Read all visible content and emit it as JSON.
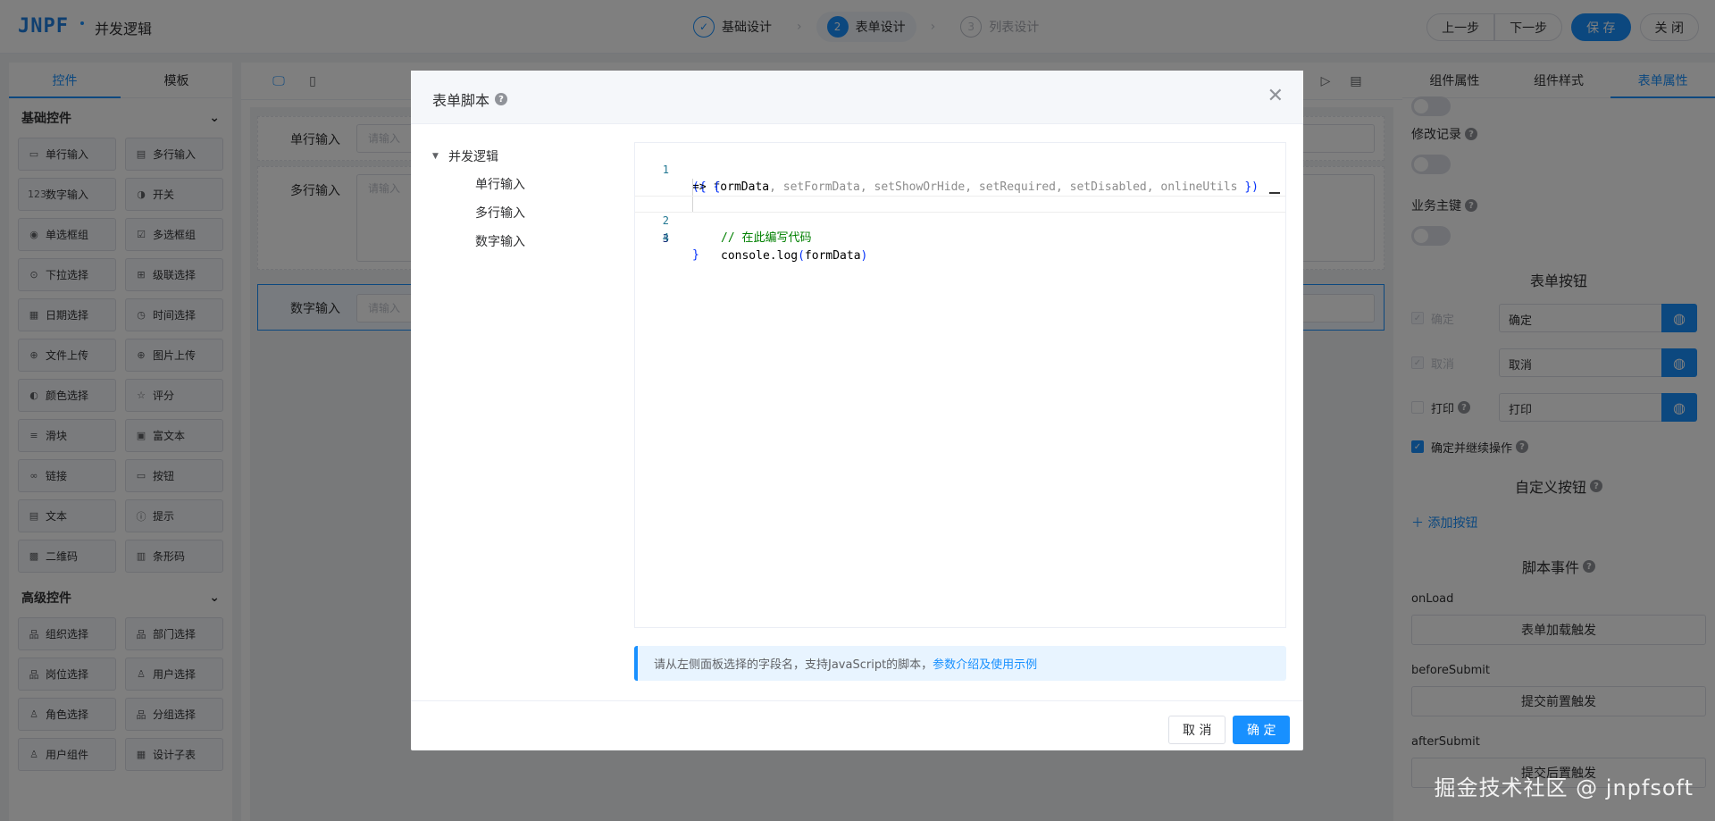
{
  "header": {
    "logo": "JNPF",
    "app_title": "并发逻辑",
    "steps": [
      {
        "num": "✓",
        "label": "基础设计"
      },
      {
        "num": "2",
        "label": "表单设计"
      },
      {
        "num": "3",
        "label": "列表设计"
      }
    ],
    "prev_label": "上一步",
    "next_label": "下一步",
    "save_label": "保 存",
    "close_label": "关 闭"
  },
  "left_panel": {
    "tabs": [
      "控件",
      "模板"
    ],
    "basic_group": "基础控件",
    "basic_items": [
      {
        "icon": "▭",
        "label": "单行输入"
      },
      {
        "icon": "▤",
        "label": "多行输入"
      },
      {
        "icon": "123",
        "label": "数字输入"
      },
      {
        "icon": "◑",
        "label": "开关"
      },
      {
        "icon": "◉",
        "label": "单选框组"
      },
      {
        "icon": "☑",
        "label": "多选框组"
      },
      {
        "icon": "⊙",
        "label": "下拉选择"
      },
      {
        "icon": "⊞",
        "label": "级联选择"
      },
      {
        "icon": "▦",
        "label": "日期选择"
      },
      {
        "icon": "◷",
        "label": "时间选择"
      },
      {
        "icon": "⊕",
        "label": "文件上传"
      },
      {
        "icon": "⊕",
        "label": "图片上传"
      },
      {
        "icon": "◐",
        "label": "颜色选择"
      },
      {
        "icon": "☆",
        "label": "评分"
      },
      {
        "icon": "≡",
        "label": "滑块"
      },
      {
        "icon": "▣",
        "label": "富文本"
      },
      {
        "icon": "∞",
        "label": "链接"
      },
      {
        "icon": "▭",
        "label": "按钮"
      },
      {
        "icon": "▤",
        "label": "文本"
      },
      {
        "icon": "ⓘ",
        "label": "提示"
      },
      {
        "icon": "▩",
        "label": "二维码"
      },
      {
        "icon": "▥",
        "label": "条形码"
      }
    ],
    "advanced_group": "高级控件",
    "advanced_items": [
      {
        "icon": "品",
        "label": "组织选择"
      },
      {
        "icon": "品",
        "label": "部门选择"
      },
      {
        "icon": "品",
        "label": "岗位选择"
      },
      {
        "icon": "♙",
        "label": "用户选择"
      },
      {
        "icon": "♙",
        "label": "角色选择"
      },
      {
        "icon": "品",
        "label": "分组选择"
      },
      {
        "icon": "♙",
        "label": "用户组件"
      },
      {
        "icon": "▦",
        "label": "设计子表"
      }
    ]
  },
  "canvas": {
    "fields": [
      {
        "label": "单行输入",
        "placeholder": "请输入"
      },
      {
        "label": "多行输入",
        "placeholder": "请输入"
      },
      {
        "label": "数字输入",
        "placeholder": "请输入"
      }
    ]
  },
  "right_panel": {
    "tabs": [
      "组件属性",
      "组件样式",
      "表单属性"
    ],
    "modify_record": "修改记录",
    "business_key": "业务主键",
    "form_buttons_title": "表单按钮",
    "buttons": [
      {
        "label": "确定",
        "value": "确定"
      },
      {
        "label": "取消",
        "value": "取消"
      },
      {
        "label": "打印",
        "value": "打印"
      }
    ],
    "confirm_continue": "确定并继续操作",
    "custom_buttons_title": "自定义按钮",
    "add_button": "＋ 添加按钮",
    "script_events_title": "脚本事件",
    "events": [
      {
        "name": "onLoad",
        "button": "表单加载触发"
      },
      {
        "name": "beforeSubmit",
        "button": "提交前置触发"
      },
      {
        "name": "afterSubmit",
        "button": "提交后置触发"
      }
    ]
  },
  "modal": {
    "title": "表单脚本",
    "tree": {
      "root": "并发逻辑",
      "children": [
        "单行输入",
        "多行输入",
        "数字输入"
      ]
    },
    "code": {
      "line_numbers": [
        "1",
        "2",
        "3",
        "4"
      ],
      "l1_open": "({ ",
      "l1_formdata": "formData",
      "l1_params": ", setFormData, setShowOrHide, setRequired, setDisabled, onlineUtils ",
      "l1_close": "})",
      "l1b_arrow": "=> ",
      "l1b_brace": "{",
      "l2_comment": "// 在此编写代码",
      "l3_call": "console.log",
      "l3_open": "(",
      "l3_arg": "formData",
      "l3_close": ")",
      "l4_brace": "}"
    },
    "tip_text": "请从左侧面板选择的字段名，支持JavaScript的脚本，",
    "tip_link": "参数介绍及使用示例",
    "cancel_label": "取 消",
    "ok_label": "确 定"
  },
  "watermark": "掘金技术社区 @ jnpfsoft"
}
